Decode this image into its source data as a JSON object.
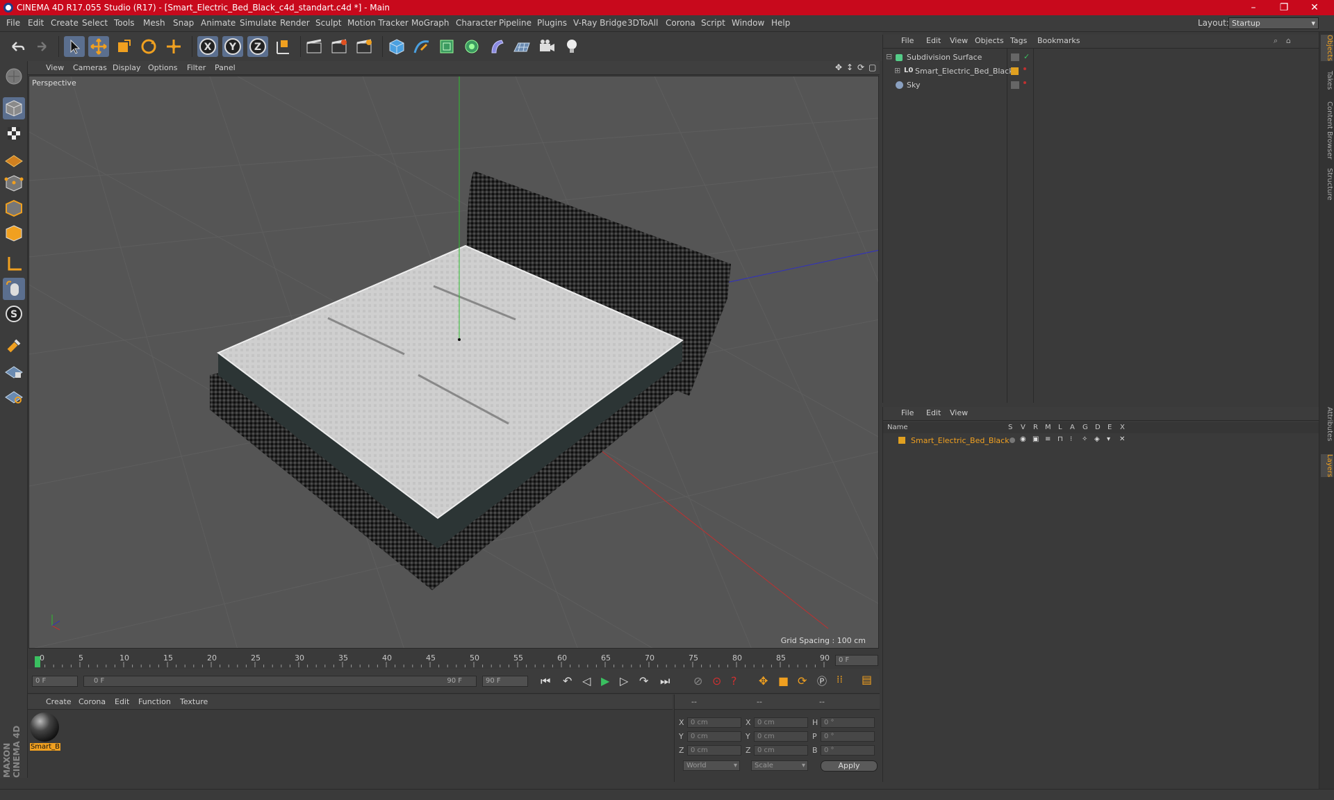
{
  "window": {
    "title": "CINEMA 4D R17.055 Studio (R17) - [Smart_Electric_Bed_Black_c4d_standart.c4d *] - Main",
    "minimize": "–",
    "maximize": "❐",
    "close": "✕"
  },
  "menubar": {
    "items": [
      "File",
      "Edit",
      "Create",
      "Select",
      "Tools",
      "Mesh",
      "Snap",
      "Animate",
      "Simulate",
      "Render",
      "Sculpt",
      "Motion Tracker",
      "MoGraph",
      "Character",
      "Pipeline",
      "Plugins",
      "V-Ray Bridge",
      "3DToAll",
      "Corona",
      "Script",
      "Window",
      "Help"
    ],
    "layout_label": "Layout:",
    "layout_value": "Startup"
  },
  "viewport": {
    "menu": [
      "View",
      "Cameras",
      "Display",
      "Options",
      "Filter",
      "Panel"
    ],
    "camera_label": "Perspective",
    "grid_spacing": "Grid Spacing : 100 cm"
  },
  "timeline": {
    "ticks": [
      "0",
      "5",
      "10",
      "15",
      "20",
      "25",
      "30",
      "35",
      "40",
      "45",
      "50",
      "55",
      "60",
      "65",
      "70",
      "75",
      "80",
      "85",
      "90"
    ],
    "current_frame": "0 F",
    "start_frame": "0 F",
    "range_start": "0 F",
    "range_end": "90 F",
    "end_frame": "90 F"
  },
  "material_manager": {
    "menu": [
      "Create",
      "Corona",
      "Edit",
      "Function",
      "Texture"
    ],
    "materials": [
      {
        "name": "Smart_B"
      }
    ]
  },
  "coordinates": {
    "headers": [
      "--",
      "--",
      "--"
    ],
    "rows": [
      {
        "a": "X",
        "av": "0 cm",
        "b": "X",
        "bv": "0 cm",
        "c": "H",
        "cv": "0 °"
      },
      {
        "a": "Y",
        "av": "0 cm",
        "b": "Y",
        "bv": "0 cm",
        "c": "P",
        "cv": "0 °"
      },
      {
        "a": "Z",
        "av": "0 cm",
        "b": "Z",
        "bv": "0 cm",
        "c": "B",
        "cv": "0 °"
      }
    ],
    "mode": "World",
    "transform": "Scale",
    "apply": "Apply"
  },
  "object_manager": {
    "menu": [
      "File",
      "Edit",
      "View",
      "Objects",
      "Tags",
      "Bookmarks"
    ],
    "objects": [
      {
        "name": "Subdivision Surface",
        "icon": "subdivision-icon",
        "color": "#55cc88"
      },
      {
        "name": "Smart_Electric_Bed_Black",
        "icon": "null-object-icon",
        "color": "#e0a020"
      },
      {
        "name": "Sky",
        "icon": "sky-icon",
        "color": "#8aa0c0"
      }
    ]
  },
  "layer_manager": {
    "menu": [
      "File",
      "Edit",
      "View"
    ],
    "columns": [
      "Name",
      "S",
      "V",
      "R",
      "M",
      "L",
      "A",
      "G",
      "D",
      "E",
      "X"
    ],
    "layers": [
      {
        "name": "Smart_Electric_Bed_Black",
        "color": "#e0a020"
      }
    ]
  },
  "side_tabs": [
    "Objects",
    "Takes",
    "Content Browser",
    "Structure",
    "Attributes",
    "Layers"
  ],
  "branding": "MAXON CINEMA 4D"
}
